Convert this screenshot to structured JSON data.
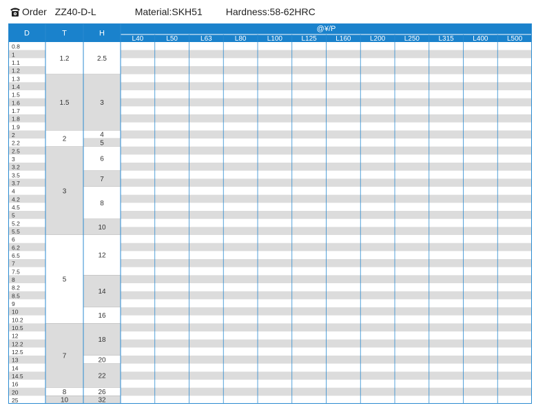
{
  "header": {
    "order_label": "Order",
    "order_code": "ZZ40-D-L",
    "material": "Material:SKH51",
    "hardness": "Hardness:58-62HRC"
  },
  "table": {
    "col_headers": {
      "d": "D",
      "t": "T",
      "h": "H",
      "price": "@¥/P"
    },
    "lengths": [
      "L40",
      "L50",
      "L63",
      "L80",
      "L100",
      "L125",
      "L160",
      "L200",
      "L250",
      "L315",
      "L400",
      "L500"
    ],
    "d_values": [
      "0.8",
      "1",
      "1.1",
      "1.2",
      "1.3",
      "1.4",
      "1.5",
      "1.6",
      "1.7",
      "1.8",
      "1.9",
      "2",
      "2.2",
      "2.5",
      "3",
      "3.2",
      "3.5",
      "3.7",
      "4",
      "4.2",
      "4.5",
      "5",
      "5.2",
      "5.5",
      "6",
      "6.2",
      "6.5",
      "7",
      "7.5",
      "8",
      "8.2",
      "8.5",
      "9",
      "10",
      "10.2",
      "10.5",
      "12",
      "12.2",
      "12.5",
      "13",
      "14",
      "14.5",
      "16",
      "20",
      "25"
    ],
    "t_groups": [
      {
        "value": "1.2",
        "start": 0,
        "end": 3
      },
      {
        "value": "1.5",
        "start": 4,
        "end": 10
      },
      {
        "value": "2",
        "start": 11,
        "end": 12
      },
      {
        "value": "3",
        "start": 13,
        "end": 23
      },
      {
        "value": "5",
        "start": 24,
        "end": 34
      },
      {
        "value": "7",
        "start": 35,
        "end": 42
      },
      {
        "value": "8",
        "start": 43,
        "end": 43
      },
      {
        "value": "10",
        "start": 44,
        "end": 44
      }
    ],
    "h_groups": [
      {
        "value": "2.5",
        "start": 0,
        "end": 3
      },
      {
        "value": "3",
        "start": 4,
        "end": 10
      },
      {
        "value": "4",
        "start": 11,
        "end": 11
      },
      {
        "value": "5",
        "start": 12,
        "end": 12
      },
      {
        "value": "6",
        "start": 13,
        "end": 15
      },
      {
        "value": "7",
        "start": 16,
        "end": 17
      },
      {
        "value": "8",
        "start": 18,
        "end": 21
      },
      {
        "value": "10",
        "start": 22,
        "end": 23
      },
      {
        "value": "12",
        "start": 24,
        "end": 28
      },
      {
        "value": "14",
        "start": 29,
        "end": 32
      },
      {
        "value": "16",
        "start": 33,
        "end": 34
      },
      {
        "value": "18",
        "start": 35,
        "end": 38
      },
      {
        "value": "20",
        "start": 39,
        "end": 39
      },
      {
        "value": "22",
        "start": 40,
        "end": 42
      },
      {
        "value": "26",
        "start": 43,
        "end": 43
      },
      {
        "value": "32",
        "start": 44,
        "end": 44
      }
    ]
  },
  "colors": {
    "header_blue": "#1a82cc",
    "stripe_gray": "#dcdcdc",
    "group_shade": "#dcdcdc",
    "line_blue": "#2a8ad0"
  }
}
